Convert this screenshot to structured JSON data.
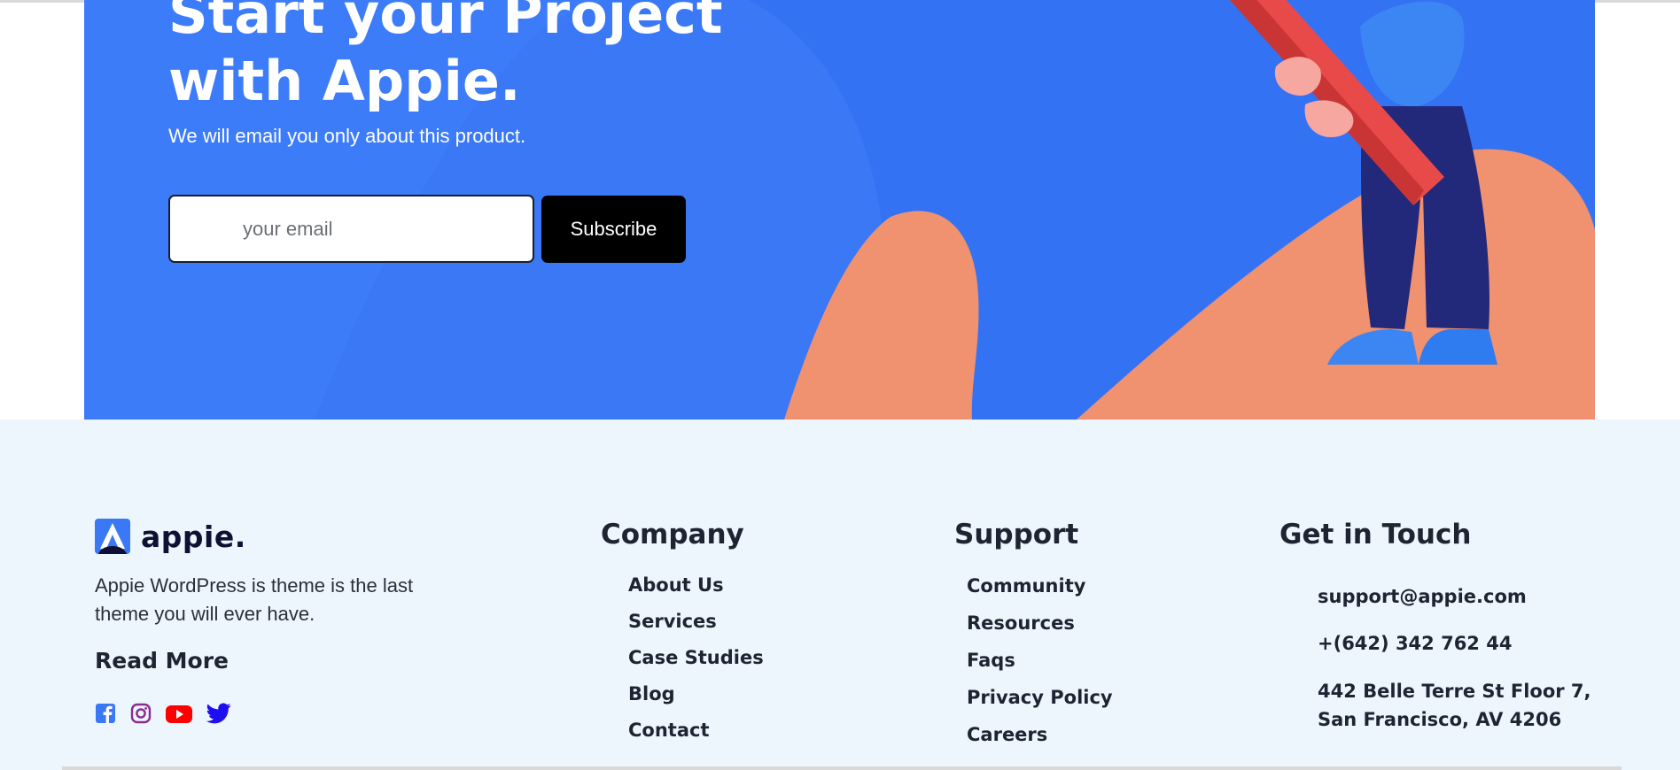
{
  "hero": {
    "title_line1": "Start your Project",
    "title_line2": "with Appie.",
    "subtitle": "We will email you only about this product.",
    "email_placeholder": "your email",
    "subscribe_label": "Subscribe",
    "colors": {
      "background": "#3a78f6",
      "blob": "#f09170",
      "pencil": "#e84a4a",
      "figure": "#22287a"
    }
  },
  "footer": {
    "brand": {
      "name": "appie.",
      "description": "Appie WordPress is theme is the last theme you will ever have.",
      "read_more": "Read More",
      "socials": [
        {
          "icon": "facebook-icon",
          "color": "#3a78f6"
        },
        {
          "icon": "instagram-icon",
          "color": "#8a2b8f"
        },
        {
          "icon": "youtube-icon",
          "color": "#ff0000"
        },
        {
          "icon": "twitter-icon",
          "color": "#1d0ff0"
        }
      ]
    },
    "company": {
      "title": "Company",
      "links": [
        "About Us",
        "Services",
        "Case Studies",
        "Blog",
        "Contact"
      ]
    },
    "support": {
      "title": "Support",
      "links": [
        "Community",
        "Resources",
        "Faqs",
        "Privacy Policy",
        "Careers"
      ]
    },
    "contact": {
      "title": "Get in Touch",
      "email": "support@appie.com",
      "phone": "+(642) 342 762 44",
      "address": "442 Belle Terre St Floor 7, San Francisco, AV 4206"
    },
    "background": "#eef6fd"
  }
}
